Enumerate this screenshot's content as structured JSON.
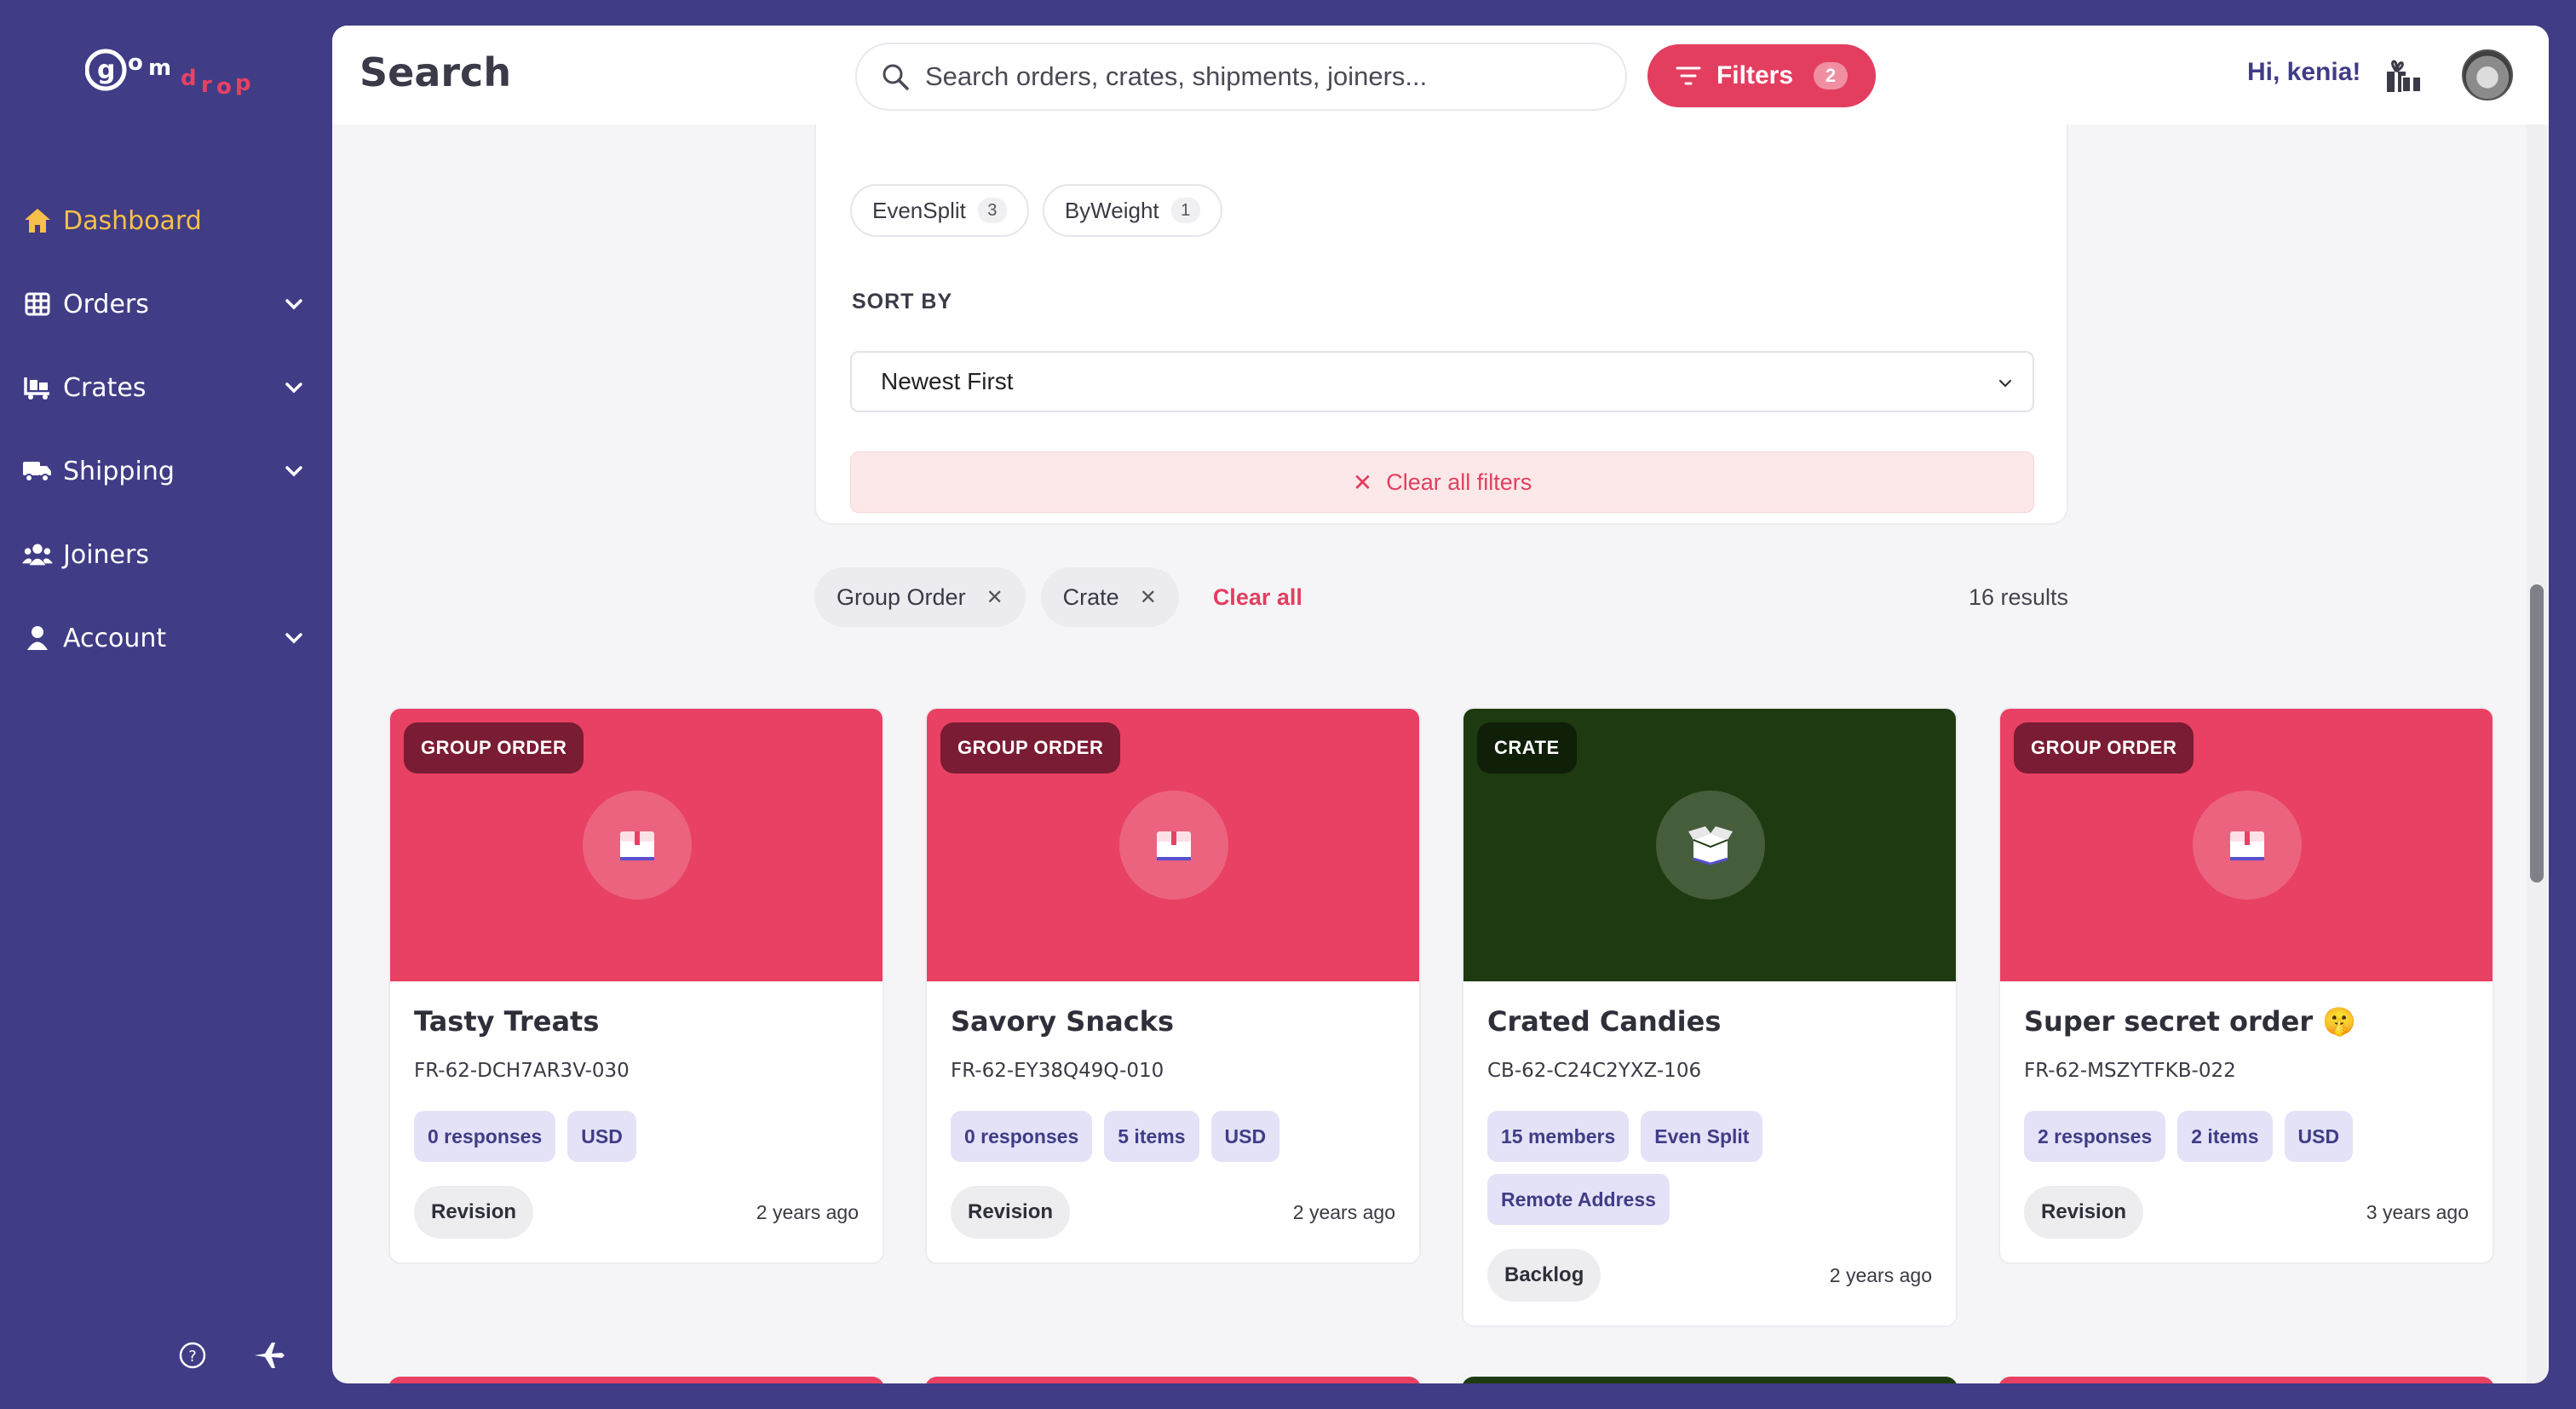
{
  "app": {
    "logo_text": "gomdrop",
    "accent": "#e33e60",
    "brand_bg": "#403c86"
  },
  "sidebar": {
    "items": [
      {
        "label": "Dashboard",
        "icon": "home-icon",
        "active": true
      },
      {
        "label": "Orders",
        "icon": "grid-icon",
        "expandable": true
      },
      {
        "label": "Crates",
        "icon": "crate-icon",
        "expandable": true
      },
      {
        "label": "Shipping",
        "icon": "truck-icon",
        "expandable": true
      },
      {
        "label": "Joiners",
        "icon": "users-icon"
      },
      {
        "label": "Account",
        "icon": "user-icon",
        "expandable": true
      }
    ],
    "bottom_icons": [
      "help-icon",
      "airplane-icon"
    ]
  },
  "header": {
    "title": "Search",
    "search_placeholder": "Search orders, crates, shipments, joiners...",
    "filters_label": "Filters",
    "filters_count": "2",
    "greeting": "Hi, kenia!"
  },
  "filter_panel": {
    "split_chips": [
      {
        "label": "EvenSplit",
        "count": "3"
      },
      {
        "label": "ByWeight",
        "count": "1"
      }
    ],
    "sort_label": "SORT BY",
    "sort_value": "Newest First",
    "clear_all_filters": "Clear all filters"
  },
  "active_filters": {
    "chips": [
      "Group Order",
      "Crate"
    ],
    "clear_all": "Clear all",
    "results": "16 results"
  },
  "cards": [
    {
      "type": "GROUP ORDER",
      "name": "Tasty Treats",
      "code": "FR-62-DCH7AR3V-030",
      "tags": [
        "0 responses",
        "USD"
      ],
      "status": "Revision",
      "ago": "2 years ago",
      "color": "#e84163"
    },
    {
      "type": "GROUP ORDER",
      "name": "Savory Snacks",
      "code": "FR-62-EY38Q49Q-010",
      "tags": [
        "0 responses",
        "5 items",
        "USD"
      ],
      "status": "Revision",
      "ago": "2 years ago",
      "color": "#e84163"
    },
    {
      "type": "CRATE",
      "name": "Crated Candies",
      "code": "CB-62-C24C2YXZ-106",
      "tags": [
        "15 members",
        "Even Split",
        "Remote Address"
      ],
      "status": "Backlog",
      "ago": "2 years ago",
      "color": "#1e3a10"
    },
    {
      "type": "GROUP ORDER",
      "name": "Super secret order 🤫",
      "code": "FR-62-MSZYTFKB-022",
      "tags": [
        "2 responses",
        "2 items",
        "USD"
      ],
      "status": "Revision",
      "ago": "3 years ago",
      "color": "#e84163"
    }
  ]
}
